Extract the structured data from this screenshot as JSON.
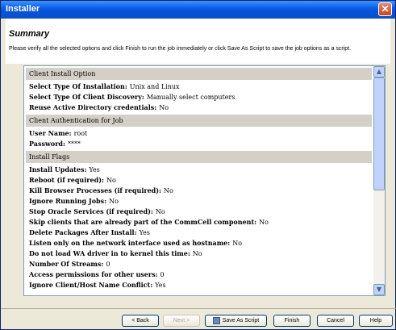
{
  "window": {
    "title": "Installer",
    "close_glyph": "✕"
  },
  "header": {
    "title": "Summary",
    "description": "Please verify all the selected options and click Finish to run the job immediately or click Save As Script to save the job options as a script."
  },
  "sections": [
    {
      "title": "Client Install Option",
      "rows": [
        {
          "label": "Select Type Of Installation:",
          "value": "Unix and Linux"
        },
        {
          "label": "Select Type Of Client Discovery:",
          "value": "Manually select computers"
        },
        {
          "label": "Reuse Active Directory credentials:",
          "value": "No"
        }
      ]
    },
    {
      "title": "Client Authentication for Job",
      "rows": [
        {
          "label": "User Name:",
          "value": "root"
        },
        {
          "label": "Password:",
          "value": "****"
        }
      ]
    },
    {
      "title": "Install Flags",
      "rows": [
        {
          "label": "Install Updates:",
          "value": "Yes"
        },
        {
          "label": "Reboot (if required):",
          "value": "No"
        },
        {
          "label": "Kill Browser Processes (if required):",
          "value": "No"
        },
        {
          "label": "Ignore Running Jobs:",
          "value": "No"
        },
        {
          "label": "Stop Oracle Services (if required):",
          "value": "No"
        },
        {
          "label": "Skip clients that are already part of the CommCell component:",
          "value": "No"
        },
        {
          "label": "Delete Packages After Install:",
          "value": "Yes"
        },
        {
          "label": "Listen only on the network interface used as hostname:",
          "value": "No"
        },
        {
          "label": "Do not load WA driver in to kernel this time:",
          "value": "No"
        },
        {
          "label": "Number Of Streams:",
          "value": "0"
        },
        {
          "label": "Access permissions for other users:",
          "value": "0"
        },
        {
          "label": "Ignore Client/Host Name Conflict:",
          "value": "Yes"
        }
      ]
    }
  ],
  "scrollbar": {
    "up_glyph": "▲",
    "down_glyph": "▼"
  },
  "buttons": {
    "back": "< Back",
    "next": "Next >",
    "save_as_script": "Save As Script",
    "finish": "Finish",
    "cancel": "Cancel",
    "help": "Help"
  }
}
